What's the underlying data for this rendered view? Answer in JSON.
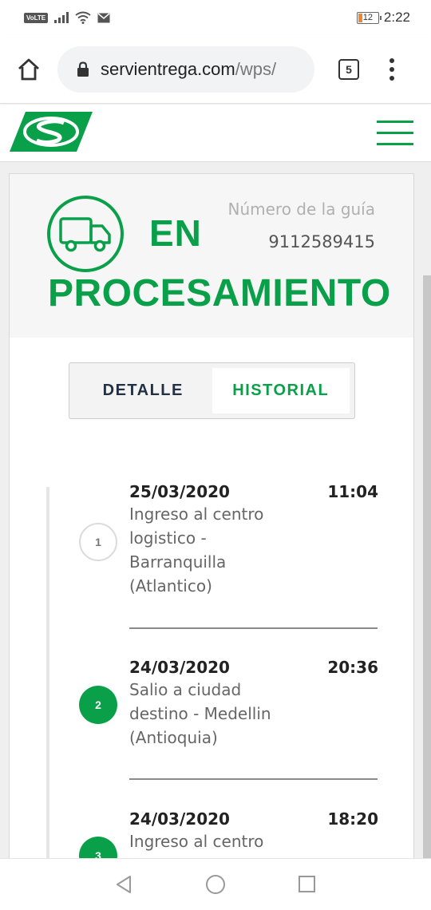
{
  "status_bar": {
    "carrier_badge": "VoLTE",
    "battery": "12",
    "time": "2:22"
  },
  "browser": {
    "url_host": "servientrega.com",
    "url_path": "/wps/",
    "tab_count": "5"
  },
  "shipment": {
    "status_line1": "EN",
    "status_line2": "PROCESAMIENTO",
    "guide_label": "Número de la guía",
    "guide_number": "9112589415"
  },
  "tabs": {
    "detalle": "DETALLE",
    "historial": "HISTORIAL",
    "active": "HISTORIAL"
  },
  "history": [
    {
      "step": "1",
      "date": "25/03/2020",
      "time": "11:04",
      "desc_lines": [
        "Ingreso al centro",
        "logistico -",
        "Barranquilla",
        "(Atlantico)"
      ]
    },
    {
      "step": "2",
      "date": "24/03/2020",
      "time": "20:36",
      "desc_lines": [
        "Salio a ciudad",
        "destino - Medellin",
        "(Antioquia)"
      ]
    },
    {
      "step": "3",
      "date": "24/03/2020",
      "time": "18:20",
      "desc_lines": [
        "Ingreso al centro"
      ]
    }
  ],
  "colors": {
    "brand_green": "#0aa04a",
    "navy": "#233044"
  }
}
